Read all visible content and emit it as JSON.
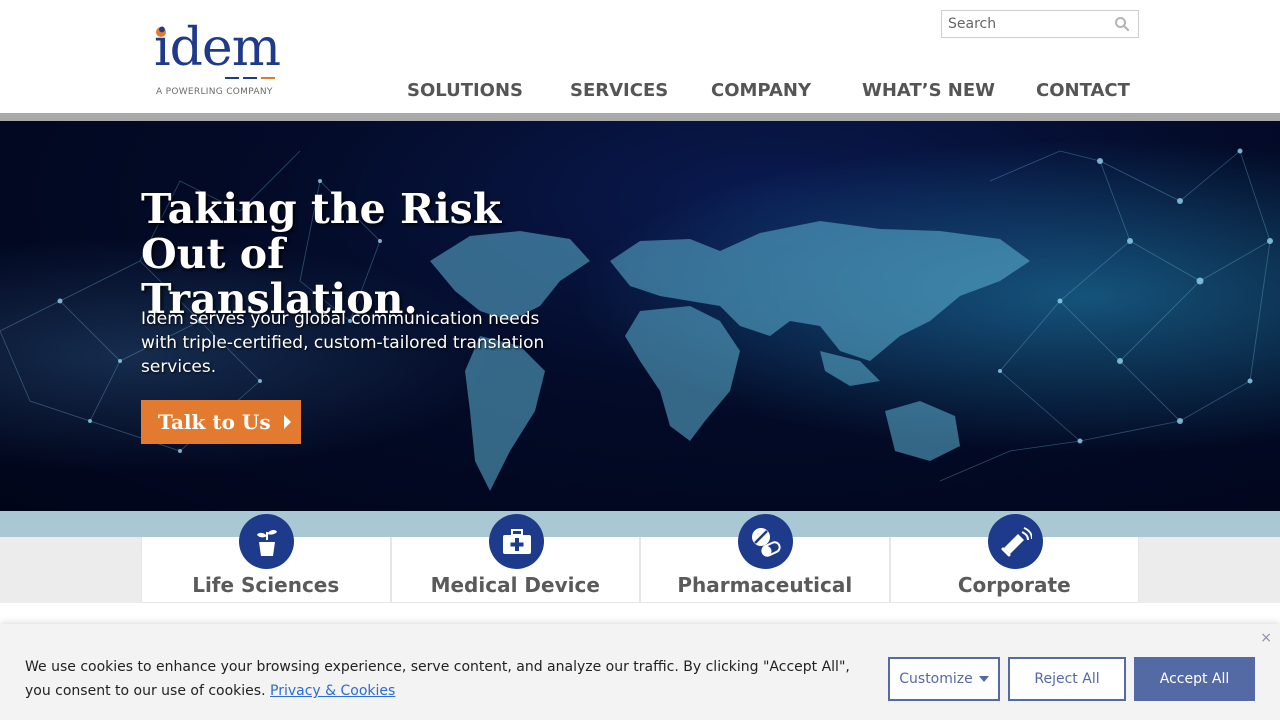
{
  "logo": {
    "word": "idem",
    "tagline": "A POWERLING COMPANY"
  },
  "search": {
    "placeholder": "Search",
    "icon": "search-icon"
  },
  "nav": {
    "items": [
      "SOLUTIONS",
      "SERVICES",
      "COMPANY",
      "WHAT’S NEW",
      "CONTACT"
    ]
  },
  "hero": {
    "title": "Taking the Risk Out of Translation.",
    "text": "Idem serves your global communication needs with triple-certified, custom-tailored translation services.",
    "button": "Talk to Us"
  },
  "industries": [
    {
      "label": "Life Sciences",
      "icon": "seedling-icon"
    },
    {
      "label": "Medical Device",
      "icon": "medical-kit-icon"
    },
    {
      "label": "Pharmaceutical",
      "icon": "pills-icon"
    },
    {
      "label": "Corporate",
      "icon": "megaphone-icon"
    }
  ],
  "cookie": {
    "text": "We use cookies to enhance your browsing experience, serve  content, and analyze our traffic. By clicking \"Accept All\", you consent to our use of cookies.",
    "link": "Privacy & Cookies",
    "customize": "Customize",
    "reject": "Reject All",
    "accept": "Accept All",
    "close": "×"
  },
  "colors": {
    "brand_blue": "#1e3a8a",
    "brand_orange": "#e27b2f",
    "button_blue": "#546aa4",
    "nav_text": "#555555"
  }
}
